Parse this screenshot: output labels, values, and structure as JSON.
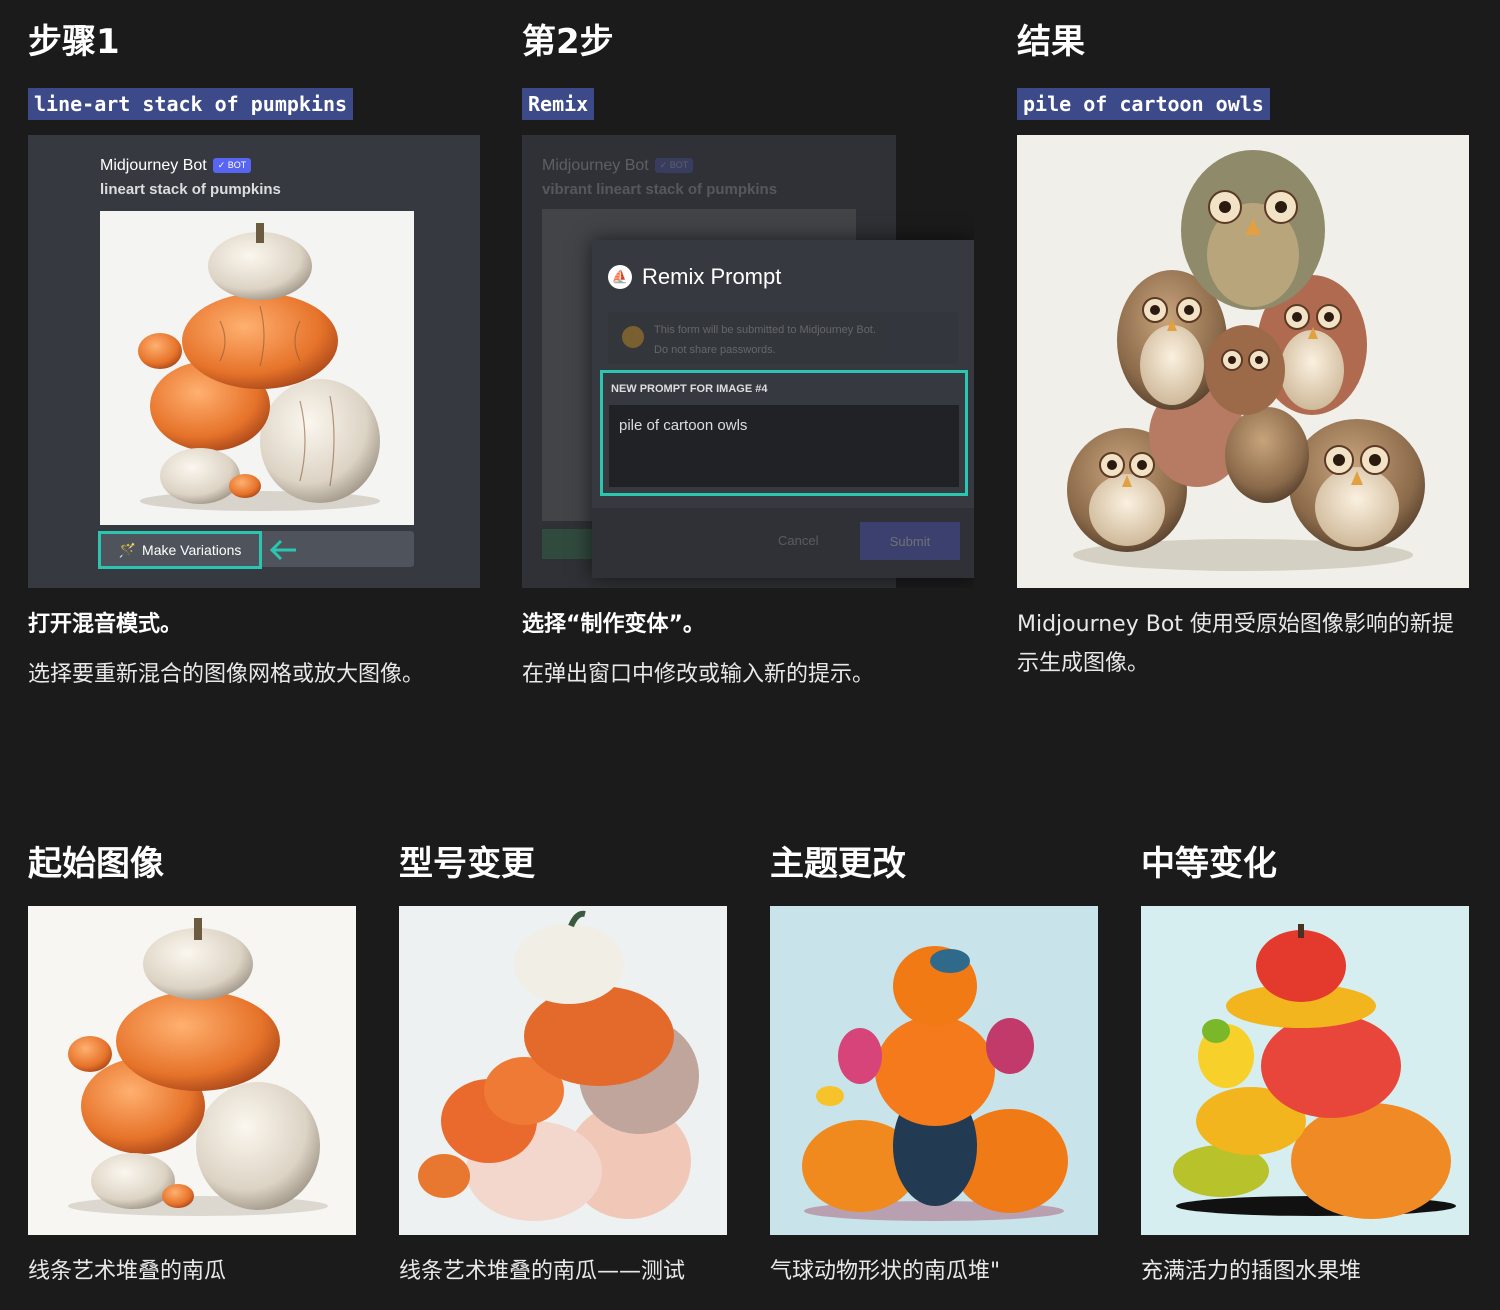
{
  "steps": [
    {
      "title": "步骤1",
      "code": "line-art stack of pumpkins",
      "bold": "打开混音模式。",
      "body": "选择要重新混合的图像网格或放大图像。"
    },
    {
      "title": "第2步",
      "code": "Remix",
      "bold": "选择“制作变体”。",
      "body": "在弹出窗口中修改或输入新的提示。"
    },
    {
      "title": "结果",
      "code": "pile of cartoon owls",
      "body": "Midjourney Bot 使用受原始图像影响的新提示生成图像。"
    }
  ],
  "discord1": {
    "author": "Midjourney Bot",
    "badge": "✓ BOT",
    "prompt": "lineart stack of pumpkins",
    "button": "Make Variations"
  },
  "discord2": {
    "author": "Midjourney Bot",
    "badge": "✓ BOT",
    "prompt": "vibrant lineart stack of pumpkins",
    "modal_title": "Remix Prompt",
    "warning_line1": "This form will be submitted to Midjourney Bot.",
    "warning_line2": "Do not share passwords.",
    "field_label": "NEW PROMPT FOR IMAGE #4",
    "field_value": "pile of cartoon owls",
    "cancel": "Cancel",
    "submit": "Submit"
  },
  "examples": [
    {
      "title": "起始图像",
      "caption": "线条艺术堆叠的南瓜"
    },
    {
      "title": "型号变更",
      "caption": "线条艺术堆叠的南瓜——测试"
    },
    {
      "title": "主题更改",
      "caption": "气球动物形状的南瓜堆\""
    },
    {
      "title": "中等变化",
      "caption": "充满活力的插图水果堆"
    }
  ],
  "colors": {
    "background": "#1b1b1b",
    "code_tag": "#3d4a8a",
    "discord_bg": "#36393f",
    "highlight": "#2bc6b2",
    "pumpkin": "#e8863a",
    "pale_pumpkin": "#e9e2d6"
  }
}
